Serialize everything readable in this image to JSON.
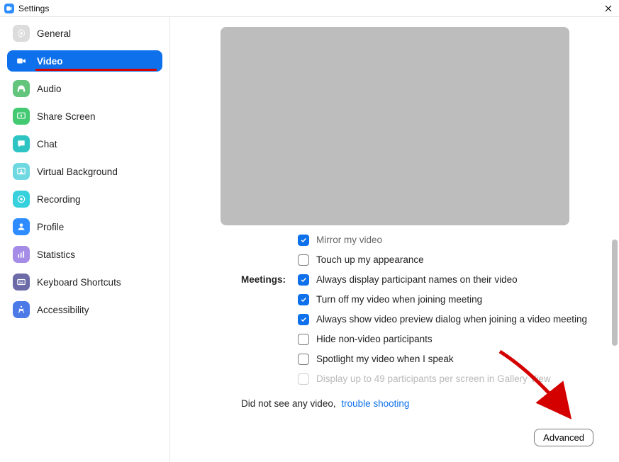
{
  "window": {
    "title": "Settings"
  },
  "sidebar": {
    "items": [
      {
        "label": "General"
      },
      {
        "label": "Video"
      },
      {
        "label": "Audio"
      },
      {
        "label": "Share Screen"
      },
      {
        "label": "Chat"
      },
      {
        "label": "Virtual Background"
      },
      {
        "label": "Recording"
      },
      {
        "label": "Profile"
      },
      {
        "label": "Statistics"
      },
      {
        "label": "Keyboard Shortcuts"
      },
      {
        "label": "Accessibility"
      }
    ],
    "active_index": 1
  },
  "video": {
    "group_label_cutoff": "",
    "group_label_meetings": "Meetings:",
    "opts": {
      "mirror": {
        "label": "Mirror my video",
        "checked": true
      },
      "touchup": {
        "label": "Touch up my appearance",
        "checked": false
      },
      "names": {
        "label": "Always display participant names on their video",
        "checked": true
      },
      "turnoff": {
        "label": "Turn off my video when joining meeting",
        "checked": true
      },
      "preview": {
        "label": "Always show video preview dialog when joining a video meeting",
        "checked": true
      },
      "hide_nonvideo": {
        "label": "Hide non-video participants",
        "checked": false
      },
      "spotlight": {
        "label": "Spotlight my video when I speak",
        "checked": false
      },
      "gallery49": {
        "label": "Display up to 49 participants per screen in Gallery View",
        "checked": false,
        "disabled": true
      }
    },
    "help_text": "Did not see any video,",
    "help_link": "trouble shooting",
    "advanced_button": "Advanced"
  }
}
